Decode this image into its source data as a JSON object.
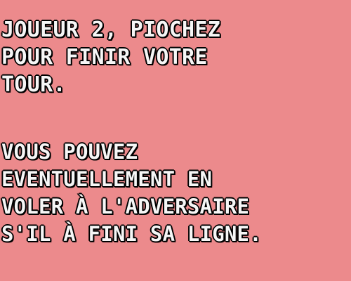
{
  "screen": {
    "background_color": "#ec8a8c",
    "text_color": "#f6f6f6",
    "outline_color": "#000000",
    "instruction": "JOUEUR 2, PIOCHEZ\nPOUR FINIR VOTRE\nTOUR.",
    "hint": "VOUS POUVEZ\nEVENTUELLEMENT EN\nVOLER À L'ADVERSAIRE\nS'IL À FINI SA LIGNE."
  }
}
